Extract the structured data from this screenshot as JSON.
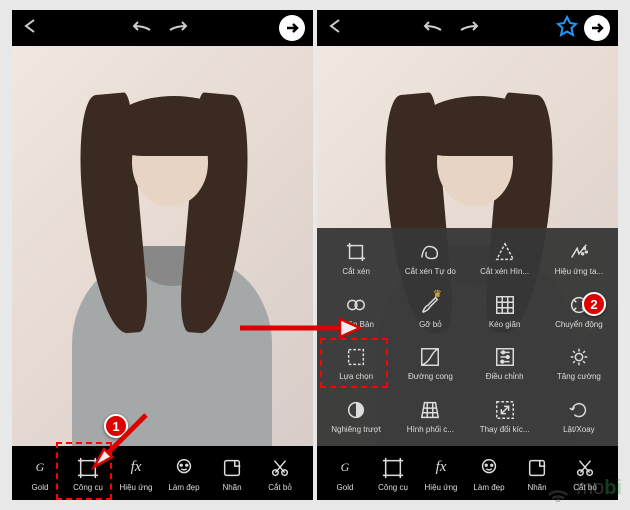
{
  "topbar": {
    "icons": {
      "back": "back-icon",
      "undo": "undo-icon",
      "redo": "redo-icon",
      "star": "star-icon",
      "next": "next-icon"
    }
  },
  "bottombar": {
    "gold": "Gold",
    "tools": "Công cụ",
    "effects": "Hiệu ứng",
    "beauty": "Làm đẹp",
    "sticker": "Nhãn",
    "cutout": "Cắt bỏ"
  },
  "toolpanel": {
    "r1c1": "Cắt xén",
    "r1c2": "Cắt xén Tự do",
    "r1c3": "Cắt xén Hìn...",
    "r1c4": "Hiệu ứng ta...",
    "r2c1": "Nhân Bản",
    "r2c2": "Gỡ bỏ",
    "r2c3": "Kéo giãn",
    "r2c4": "Chuyển động",
    "r3c1": "Lựa chọn",
    "r3c2": "Đường cong",
    "r3c3": "Điều chỉnh",
    "r3c4": "Tăng cường",
    "r4c1": "Nghiêng trượt",
    "r4c2": "Hình phối c...",
    "r4c3": "Thay đổi kíc...",
    "r4c4": "Lật/Xoay"
  },
  "annotations": {
    "badge1": "1",
    "badge2": "2"
  },
  "watermark": {
    "part1": "mo",
    "part2": "bi"
  }
}
